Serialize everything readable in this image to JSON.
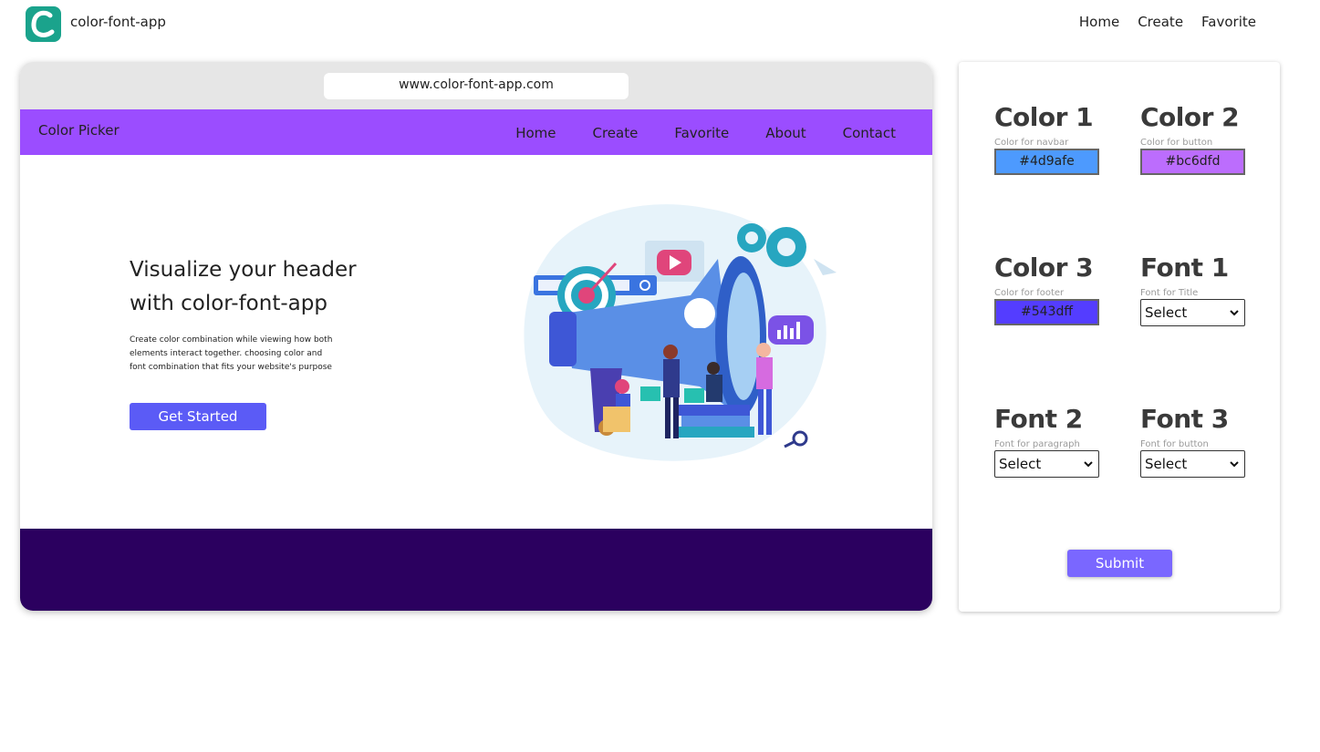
{
  "app": {
    "brand": "color-font-app",
    "nav": [
      "Home",
      "Create",
      "Favorite"
    ]
  },
  "preview": {
    "url": "www.color-font-app.com",
    "navbar_brand": "Color Picker",
    "navbar_links": [
      "Home",
      "Create",
      "Favorite",
      "About",
      "Contact"
    ],
    "hero_title": "Visualize your header with color-font-app",
    "hero_text": "Create color combination while viewing how both elements interact together. choosing color and font combination that fits your website's purpose",
    "cta": "Get Started"
  },
  "controls": {
    "color1": {
      "title": "Color 1",
      "sub": "Color for navbar",
      "value": "#4d9afe"
    },
    "color2": {
      "title": "Color 2",
      "sub": "Color for button",
      "value": "#bc6dfd"
    },
    "color3": {
      "title": "Color 3",
      "sub": "Color for footer",
      "value": "#543dff"
    },
    "font1": {
      "title": "Font 1",
      "sub": "Font for Title",
      "value": "Select"
    },
    "font2": {
      "title": "Font 2",
      "sub": "Font for paragraph",
      "value": "Select"
    },
    "font3": {
      "title": "Font 3",
      "sub": "Font for button",
      "value": "Select"
    },
    "submit": "Submit"
  },
  "colors": {
    "logo": "#1aa38c",
    "preview_navbar": "#9b4dff",
    "preview_button": "#5b5bf6",
    "preview_footer": "#2b005f",
    "submit": "#7a67ff"
  }
}
